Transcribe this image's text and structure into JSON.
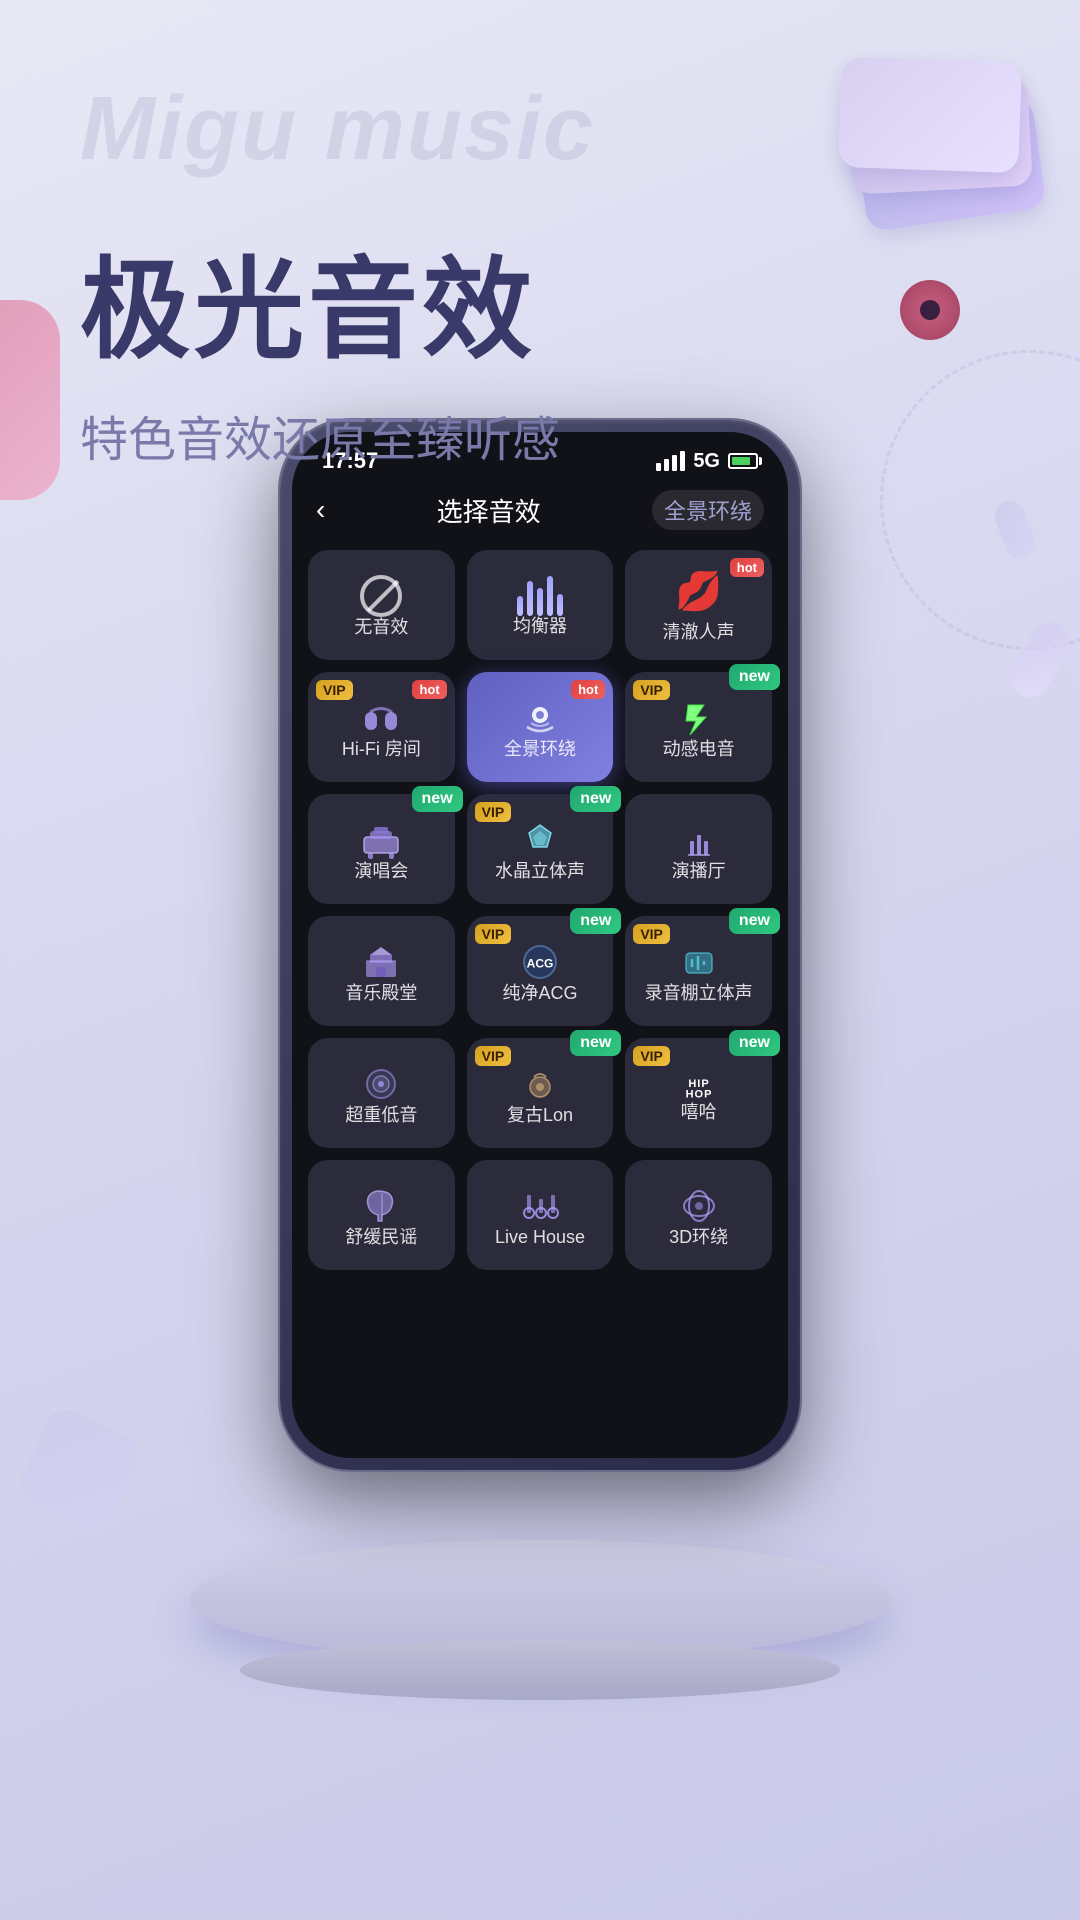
{
  "app": {
    "watermark": "Migu\nmusic",
    "main_title": "极光音效",
    "sub_title": "特色音效还原至臻听感"
  },
  "status_bar": {
    "time": "17:57",
    "network": "5G",
    "signal_label": "signal"
  },
  "screen": {
    "back_label": "‹",
    "title": "选择音效",
    "header_tag": "全景环绕"
  },
  "effects": [
    {
      "id": "no-effect",
      "label": "无音效",
      "icon_type": "slash",
      "vip": false,
      "hot": false,
      "new": false,
      "active": false
    },
    {
      "id": "equalizer",
      "label": "均衡器",
      "icon_type": "equalizer",
      "vip": false,
      "hot": false,
      "new": false,
      "active": false
    },
    {
      "id": "clear-voice",
      "label": "清澈人声",
      "icon_type": "lips",
      "vip": false,
      "hot": true,
      "new": false,
      "active": false
    },
    {
      "id": "hifi-room",
      "label": "Hi-Fi 房间",
      "icon_type": "hifi",
      "vip": true,
      "hot": true,
      "new": false,
      "active": false
    },
    {
      "id": "panoramic",
      "label": "全景环绕",
      "icon_type": "panoramic",
      "vip": false,
      "hot": true,
      "new": false,
      "active": true
    },
    {
      "id": "dynamic-sound",
      "label": "动感电音",
      "icon_type": "dynamic",
      "vip": true,
      "hot": false,
      "new": true,
      "active": false
    },
    {
      "id": "concert",
      "label": "演唱会",
      "icon_type": "concert",
      "vip": false,
      "hot": false,
      "new": true,
      "active": false
    },
    {
      "id": "crystal-stereo",
      "label": "水晶立体声",
      "icon_type": "crystal",
      "vip": true,
      "hot": false,
      "new": true,
      "active": false
    },
    {
      "id": "performance-hall",
      "label": "演播厅",
      "icon_type": "hall",
      "vip": false,
      "hot": false,
      "new": false,
      "active": false
    },
    {
      "id": "music-palace",
      "label": "音乐殿堂",
      "icon_type": "palace",
      "vip": false,
      "hot": false,
      "new": false,
      "active": false
    },
    {
      "id": "pure-acg",
      "label": "纯净ACG",
      "icon_type": "acg",
      "vip": true,
      "hot": false,
      "new": true,
      "active": false
    },
    {
      "id": "studio-stereo",
      "label": "录音棚立体声",
      "icon_type": "studio",
      "vip": true,
      "hot": false,
      "new": true,
      "active": false
    },
    {
      "id": "heavy-bass",
      "label": "超重低音",
      "icon_type": "bass",
      "vip": false,
      "hot": false,
      "new": false,
      "active": false
    },
    {
      "id": "retro-london",
      "label": "复古Lon",
      "icon_type": "retro",
      "vip": true,
      "hot": false,
      "new": true,
      "active": false
    },
    {
      "id": "hiphop",
      "label": "嘻哈",
      "icon_type": "hiphop",
      "vip": true,
      "hot": false,
      "new": true,
      "active": false
    },
    {
      "id": "folk",
      "label": "舒缓民谣",
      "icon_type": "folk",
      "vip": false,
      "hot": false,
      "new": false,
      "active": false
    },
    {
      "id": "live-house",
      "label": "Live House",
      "icon_type": "livehouse",
      "vip": false,
      "hot": false,
      "new": false,
      "active": false
    },
    {
      "id": "3d-surround",
      "label": "3D环绕",
      "icon_type": "3d",
      "vip": false,
      "hot": false,
      "new": false,
      "active": false
    }
  ],
  "colors": {
    "vip_gold": "#d4a020",
    "hot_red": "#e04040",
    "new_green": "#20a870",
    "active_blue": "#6060c0",
    "bg_light": "#e8e8f5"
  }
}
